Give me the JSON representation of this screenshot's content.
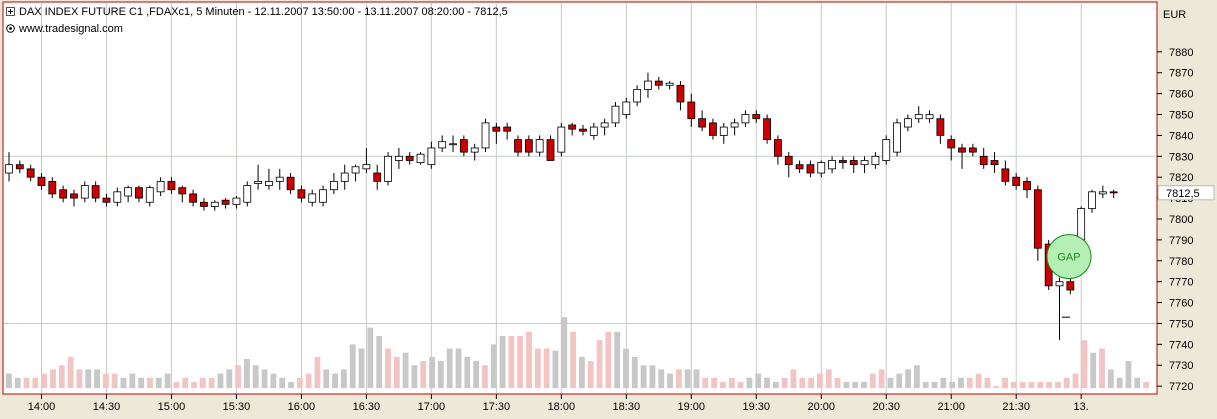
{
  "header": {
    "title": "DAX INDEX FUTURE C1 ,FDAXc1, 5 Minuten - 12.11.2007 13:50:00 - 13.11.2007 08:20:00 - 7812,5",
    "source": "www.tradesignal.com"
  },
  "colors": {
    "up": "#ffffff",
    "down": "#cc0000",
    "volume_up": "#c8c8c8",
    "volume_down": "#f2c4c4",
    "gap_fill": "#b4f0b4",
    "gap_stroke": "#1e8c1e",
    "grid": "#c4ccc4",
    "border": "#c00000",
    "panel": "#ece9d8",
    "plot": "#ffffff"
  },
  "chart_data": {
    "type": "candlestick",
    "currency_label": "EUR",
    "last_price_label": "7812,5",
    "ylim": [
      7720,
      7890
    ],
    "y_ticks": [
      7720,
      7730,
      7740,
      7750,
      7760,
      7770,
      7780,
      7790,
      7800,
      7810,
      7820,
      7830,
      7840,
      7850,
      7860,
      7870,
      7880
    ],
    "x_tick_labels": [
      "14:00",
      "14:30",
      "15:00",
      "15:30",
      "16:00",
      "16:30",
      "17:00",
      "17:30",
      "18:00",
      "18:30",
      "19:00",
      "19:30",
      "20:00",
      "20:30",
      "21:00",
      "21:30",
      "13."
    ],
    "x_tick_bar_index": [
      3,
      9,
      15,
      21,
      27,
      33,
      39,
      45,
      51,
      57,
      63,
      69,
      75,
      81,
      87,
      93,
      99
    ],
    "annotation": "GAP",
    "annotation_price": 7782,
    "gap_marker_price": 7753,
    "candles": [
      [
        7822,
        7832,
        7818,
        7826
      ],
      [
        7826,
        7828,
        7822,
        7824
      ],
      [
        7824,
        7826,
        7818,
        7820
      ],
      [
        7820,
        7822,
        7814,
        7816
      ],
      [
        7818,
        7820,
        7810,
        7812
      ],
      [
        7814,
        7816,
        7808,
        7810
      ],
      [
        7812,
        7814,
        7806,
        7810
      ],
      [
        7810,
        7818,
        7808,
        7816
      ],
      [
        7816,
        7818,
        7808,
        7810
      ],
      [
        7810,
        7812,
        7806,
        7808
      ],
      [
        7808,
        7815,
        7806,
        7813
      ],
      [
        7811,
        7816,
        7808,
        7815
      ],
      [
        7815,
        7816,
        7808,
        7810
      ],
      [
        7808,
        7816,
        7806,
        7815
      ],
      [
        7813,
        7820,
        7811,
        7818
      ],
      [
        7818,
        7820,
        7812,
        7814
      ],
      [
        7815,
        7816,
        7808,
        7812
      ],
      [
        7812,
        7814,
        7806,
        7808
      ],
      [
        7808,
        7810,
        7804,
        7806
      ],
      [
        7806,
        7809,
        7804,
        7808
      ],
      [
        7809,
        7810,
        7805,
        7807
      ],
      [
        7807,
        7811,
        7805,
        7810
      ],
      [
        7808,
        7818,
        7806,
        7816
      ],
      [
        7817,
        7826,
        7814,
        7818
      ],
      [
        7816,
        7824,
        7814,
        7818
      ],
      [
        7818,
        7824,
        7814,
        7820
      ],
      [
        7820,
        7822,
        7812,
        7814
      ],
      [
        7814,
        7816,
        7808,
        7810
      ],
      [
        7808,
        7814,
        7806,
        7812
      ],
      [
        7808,
        7816,
        7806,
        7814
      ],
      [
        7814,
        7822,
        7812,
        7818
      ],
      [
        7818,
        7826,
        7814,
        7822
      ],
      [
        7822,
        7826,
        7818,
        7825
      ],
      [
        7824,
        7834,
        7822,
        7826
      ],
      [
        7822,
        7826,
        7814,
        7818
      ],
      [
        7818,
        7832,
        7816,
        7830
      ],
      [
        7828,
        7834,
        7824,
        7830
      ],
      [
        7830,
        7832,
        7826,
        7828
      ],
      [
        7827,
        7832,
        7826,
        7831
      ],
      [
        7826,
        7837,
        7824,
        7834
      ],
      [
        7834,
        7840,
        7832,
        7837
      ],
      [
        7836,
        7840,
        7832,
        7836
      ],
      [
        7838,
        7840,
        7830,
        7832
      ],
      [
        7832,
        7836,
        7828,
        7834
      ],
      [
        7834,
        7848,
        7832,
        7846
      ],
      [
        7844,
        7846,
        7836,
        7842
      ],
      [
        7844,
        7846,
        7838,
        7842
      ],
      [
        7838,
        7840,
        7830,
        7832
      ],
      [
        7838,
        7840,
        7830,
        7832
      ],
      [
        7832,
        7840,
        7830,
        7838
      ],
      [
        7838,
        7840,
        7830,
        7828
      ],
      [
        7832,
        7846,
        7830,
        7844
      ],
      [
        7845,
        7846,
        7840,
        7843
      ],
      [
        7843,
        7845,
        7840,
        7842
      ],
      [
        7840,
        7846,
        7838,
        7844
      ],
      [
        7844,
        7848,
        7840,
        7846
      ],
      [
        7846,
        7856,
        7844,
        7854
      ],
      [
        7850,
        7858,
        7848,
        7856
      ],
      [
        7856,
        7864,
        7854,
        7862
      ],
      [
        7862,
        7870,
        7858,
        7866
      ],
      [
        7866,
        7868,
        7862,
        7864
      ],
      [
        7864,
        7866,
        7862,
        7865
      ],
      [
        7864,
        7866,
        7852,
        7856
      ],
      [
        7856,
        7860,
        7844,
        7848
      ],
      [
        7848,
        7852,
        7842,
        7844
      ],
      [
        7846,
        7848,
        7838,
        7840
      ],
      [
        7840,
        7846,
        7836,
        7844
      ],
      [
        7844,
        7848,
        7840,
        7846
      ],
      [
        7846,
        7852,
        7844,
        7850
      ],
      [
        7850,
        7852,
        7846,
        7848
      ],
      [
        7848,
        7850,
        7836,
        7838
      ],
      [
        7838,
        7840,
        7826,
        7830
      ],
      [
        7830,
        7832,
        7820,
        7826
      ],
      [
        7826,
        7828,
        7822,
        7824
      ],
      [
        7826,
        7828,
        7820,
        7822
      ],
      [
        7822,
        7828,
        7820,
        7827
      ],
      [
        7824,
        7830,
        7822,
        7828
      ],
      [
        7828,
        7830,
        7824,
        7827
      ],
      [
        7828,
        7830,
        7822,
        7826
      ],
      [
        7826,
        7830,
        7822,
        7828
      ],
      [
        7826,
        7832,
        7824,
        7830
      ],
      [
        7828,
        7840,
        7826,
        7838
      ],
      [
        7832,
        7848,
        7830,
        7846
      ],
      [
        7844,
        7850,
        7842,
        7848
      ],
      [
        7848,
        7854,
        7846,
        7850
      ],
      [
        7848,
        7852,
        7846,
        7850
      ],
      [
        7848,
        7850,
        7836,
        7840
      ],
      [
        7838,
        7840,
        7828,
        7834
      ],
      [
        7834,
        7836,
        7824,
        7832
      ],
      [
        7834,
        7836,
        7830,
        7832
      ],
      [
        7830,
        7834,
        7824,
        7826
      ],
      [
        7828,
        7832,
        7822,
        7826
      ],
      [
        7824,
        7828,
        7816,
        7818
      ],
      [
        7820,
        7822,
        7814,
        7816
      ],
      [
        7818,
        7820,
        7810,
        7814
      ],
      [
        7814,
        7816,
        7780,
        7786
      ],
      [
        7788,
        7790,
        7766,
        7768
      ],
      [
        7768,
        7772,
        7742,
        7770
      ],
      [
        7770,
        7772,
        7764,
        7766
      ],
      [
        7790,
        7806,
        7786,
        7805
      ],
      [
        7805,
        7814,
        7803,
        7813
      ],
      [
        7812,
        7816,
        7810,
        7813
      ],
      [
        7813,
        7814,
        7810,
        7812.5
      ]
    ],
    "volumes": [
      7726,
      7724,
      7724,
      7724,
      7726,
      7728,
      7730,
      7734,
      7728,
      7728,
      7728,
      7726,
      7726,
      7724,
      7726,
      7724,
      7724,
      7724,
      7726,
      7722,
      7724,
      7722,
      7724,
      7724,
      7726,
      7728,
      7730,
      7733,
      7730,
      7728,
      7726,
      7724,
      7722,
      7724,
      7726,
      7734,
      7728,
      7726,
      7728,
      7740,
      7738,
      7748,
      7744,
      7738,
      7734,
      7736,
      7730,
      7732,
      7734,
      7732,
      7738,
      7738,
      7734,
      7732,
      7730,
      7740,
      7744,
      7744,
      7744,
      7746,
      7738,
      7738,
      7737,
      7753,
      7746,
      7734,
      7732,
      7742,
      7746,
      7746,
      7738,
      7734,
      7730,
      7730,
      7728,
      7726,
      7728,
      7728,
      7728,
      7724,
      7724,
      7722,
      7724,
      7722,
      7724,
      7726,
      7724,
      7722,
      7724,
      7728,
      7724,
      7724,
      7726,
      7728,
      7724,
      7722,
      7722,
      7722,
      7726,
      7728,
      7724,
      7726,
      7728,
      7730,
      7722,
      7722,
      7724,
      7722,
      7724,
      7724,
      7726,
      7724,
      7720,
      7724,
      7722,
      7722,
      7722,
      7722,
      7722,
      7722,
      7724,
      7726,
      7742,
      7736,
      7738,
      7728,
      7724,
      7732,
      7724,
      7722
    ]
  }
}
